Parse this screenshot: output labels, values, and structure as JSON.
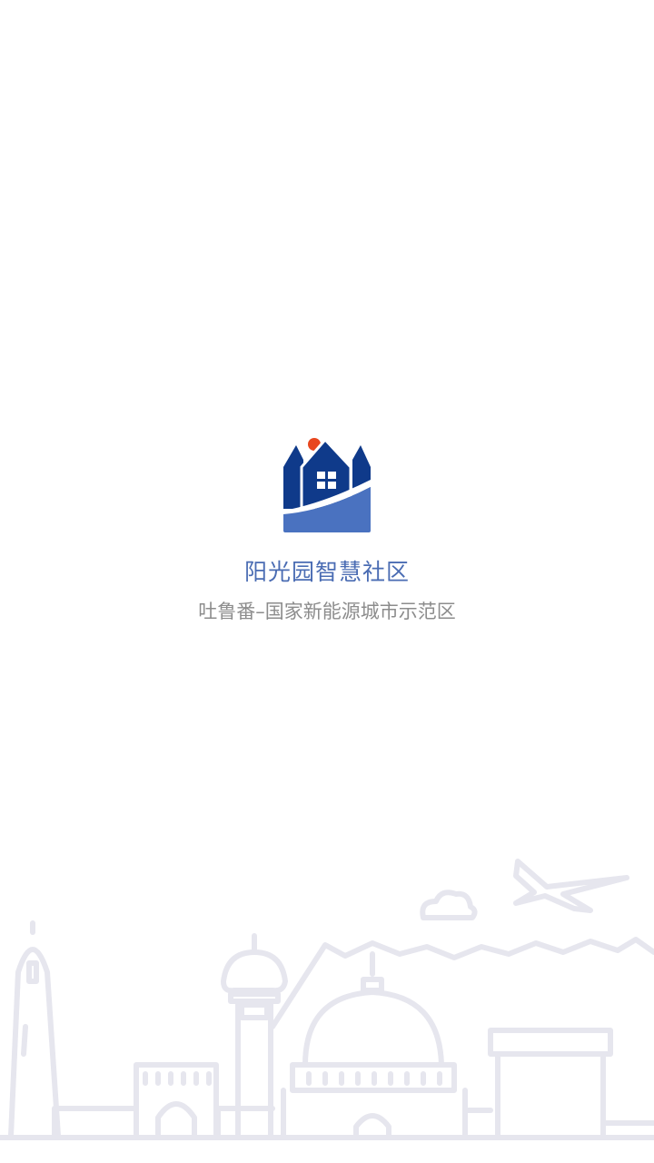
{
  "app": {
    "title": "阳光园智慧社区",
    "subtitle": "吐鲁番–国家新能源城市示范区"
  },
  "logo": {
    "icon": "community-house-logo-icon",
    "colors": {
      "navy": "#0f3a8a",
      "base_blue": "#4a72c0",
      "sun": "#e8471f",
      "window": "#ffffff"
    }
  },
  "illustration": {
    "icon": "city-skyline-illustration",
    "stroke_color": "#e6e6ee"
  },
  "theme": {
    "title_color": "#4a6cb3",
    "subtitle_color": "#8c8c8c",
    "background": "#ffffff"
  }
}
